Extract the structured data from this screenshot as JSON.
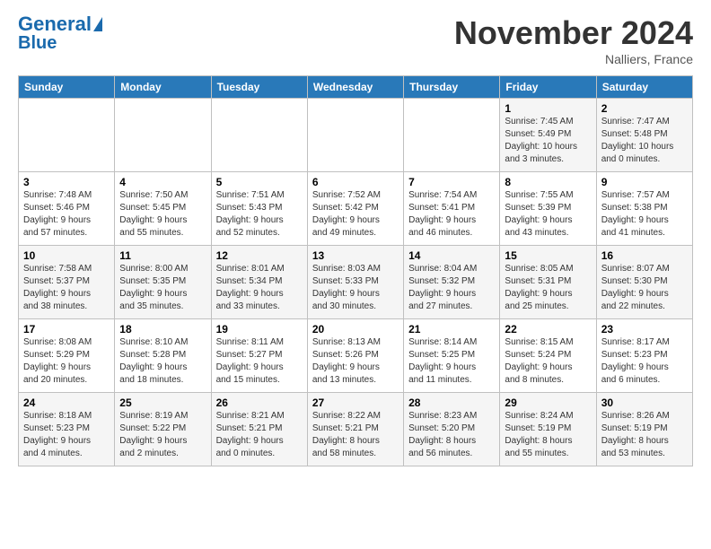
{
  "logo": {
    "text1": "General",
    "text2": "Blue"
  },
  "title": "November 2024",
  "location": "Nalliers, France",
  "headers": [
    "Sunday",
    "Monday",
    "Tuesday",
    "Wednesday",
    "Thursday",
    "Friday",
    "Saturday"
  ],
  "weeks": [
    [
      {
        "day": "",
        "info": ""
      },
      {
        "day": "",
        "info": ""
      },
      {
        "day": "",
        "info": ""
      },
      {
        "day": "",
        "info": ""
      },
      {
        "day": "",
        "info": ""
      },
      {
        "day": "1",
        "info": "Sunrise: 7:45 AM\nSunset: 5:49 PM\nDaylight: 10 hours\nand 3 minutes."
      },
      {
        "day": "2",
        "info": "Sunrise: 7:47 AM\nSunset: 5:48 PM\nDaylight: 10 hours\nand 0 minutes."
      }
    ],
    [
      {
        "day": "3",
        "info": "Sunrise: 7:48 AM\nSunset: 5:46 PM\nDaylight: 9 hours\nand 57 minutes."
      },
      {
        "day": "4",
        "info": "Sunrise: 7:50 AM\nSunset: 5:45 PM\nDaylight: 9 hours\nand 55 minutes."
      },
      {
        "day": "5",
        "info": "Sunrise: 7:51 AM\nSunset: 5:43 PM\nDaylight: 9 hours\nand 52 minutes."
      },
      {
        "day": "6",
        "info": "Sunrise: 7:52 AM\nSunset: 5:42 PM\nDaylight: 9 hours\nand 49 minutes."
      },
      {
        "day": "7",
        "info": "Sunrise: 7:54 AM\nSunset: 5:41 PM\nDaylight: 9 hours\nand 46 minutes."
      },
      {
        "day": "8",
        "info": "Sunrise: 7:55 AM\nSunset: 5:39 PM\nDaylight: 9 hours\nand 43 minutes."
      },
      {
        "day": "9",
        "info": "Sunrise: 7:57 AM\nSunset: 5:38 PM\nDaylight: 9 hours\nand 41 minutes."
      }
    ],
    [
      {
        "day": "10",
        "info": "Sunrise: 7:58 AM\nSunset: 5:37 PM\nDaylight: 9 hours\nand 38 minutes."
      },
      {
        "day": "11",
        "info": "Sunrise: 8:00 AM\nSunset: 5:35 PM\nDaylight: 9 hours\nand 35 minutes."
      },
      {
        "day": "12",
        "info": "Sunrise: 8:01 AM\nSunset: 5:34 PM\nDaylight: 9 hours\nand 33 minutes."
      },
      {
        "day": "13",
        "info": "Sunrise: 8:03 AM\nSunset: 5:33 PM\nDaylight: 9 hours\nand 30 minutes."
      },
      {
        "day": "14",
        "info": "Sunrise: 8:04 AM\nSunset: 5:32 PM\nDaylight: 9 hours\nand 27 minutes."
      },
      {
        "day": "15",
        "info": "Sunrise: 8:05 AM\nSunset: 5:31 PM\nDaylight: 9 hours\nand 25 minutes."
      },
      {
        "day": "16",
        "info": "Sunrise: 8:07 AM\nSunset: 5:30 PM\nDaylight: 9 hours\nand 22 minutes."
      }
    ],
    [
      {
        "day": "17",
        "info": "Sunrise: 8:08 AM\nSunset: 5:29 PM\nDaylight: 9 hours\nand 20 minutes."
      },
      {
        "day": "18",
        "info": "Sunrise: 8:10 AM\nSunset: 5:28 PM\nDaylight: 9 hours\nand 18 minutes."
      },
      {
        "day": "19",
        "info": "Sunrise: 8:11 AM\nSunset: 5:27 PM\nDaylight: 9 hours\nand 15 minutes."
      },
      {
        "day": "20",
        "info": "Sunrise: 8:13 AM\nSunset: 5:26 PM\nDaylight: 9 hours\nand 13 minutes."
      },
      {
        "day": "21",
        "info": "Sunrise: 8:14 AM\nSunset: 5:25 PM\nDaylight: 9 hours\nand 11 minutes."
      },
      {
        "day": "22",
        "info": "Sunrise: 8:15 AM\nSunset: 5:24 PM\nDaylight: 9 hours\nand 8 minutes."
      },
      {
        "day": "23",
        "info": "Sunrise: 8:17 AM\nSunset: 5:23 PM\nDaylight: 9 hours\nand 6 minutes."
      }
    ],
    [
      {
        "day": "24",
        "info": "Sunrise: 8:18 AM\nSunset: 5:23 PM\nDaylight: 9 hours\nand 4 minutes."
      },
      {
        "day": "25",
        "info": "Sunrise: 8:19 AM\nSunset: 5:22 PM\nDaylight: 9 hours\nand 2 minutes."
      },
      {
        "day": "26",
        "info": "Sunrise: 8:21 AM\nSunset: 5:21 PM\nDaylight: 9 hours\nand 0 minutes."
      },
      {
        "day": "27",
        "info": "Sunrise: 8:22 AM\nSunset: 5:21 PM\nDaylight: 8 hours\nand 58 minutes."
      },
      {
        "day": "28",
        "info": "Sunrise: 8:23 AM\nSunset: 5:20 PM\nDaylight: 8 hours\nand 56 minutes."
      },
      {
        "day": "29",
        "info": "Sunrise: 8:24 AM\nSunset: 5:19 PM\nDaylight: 8 hours\nand 55 minutes."
      },
      {
        "day": "30",
        "info": "Sunrise: 8:26 AM\nSunset: 5:19 PM\nDaylight: 8 hours\nand 53 minutes."
      }
    ]
  ]
}
